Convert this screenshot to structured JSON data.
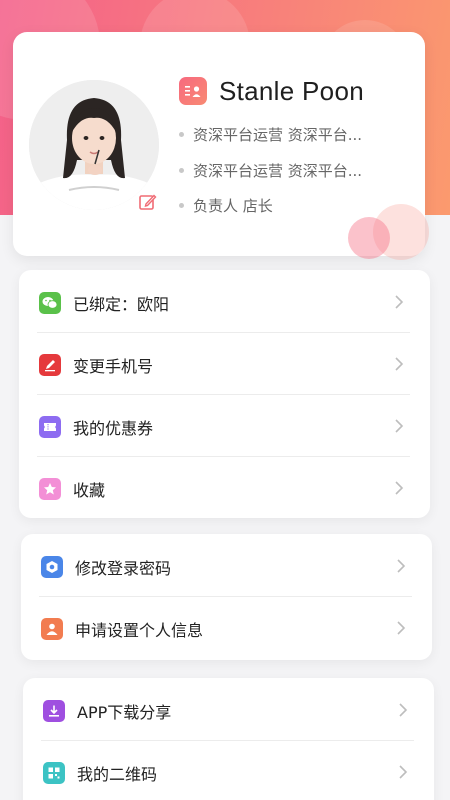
{
  "profile": {
    "name": "Stanle Poon",
    "info_lines": [
      "资深平台运营 资深平台...",
      "资深平台运营 资深平台...",
      "负责人 店长"
    ]
  },
  "menu_groups": [
    {
      "items": [
        {
          "label": "已绑定：欧阳",
          "icon": "wechat-icon",
          "color": "#5ac14a"
        },
        {
          "label": "变更手机号",
          "icon": "edit-phone-icon",
          "color": "#e5393c"
        },
        {
          "label": "我的优惠券",
          "icon": "coupon-icon",
          "color": "#8d6cf1"
        },
        {
          "label": "收藏",
          "icon": "star-icon",
          "color": "#f38fd6"
        }
      ]
    },
    {
      "items": [
        {
          "label": "修改登录密码",
          "icon": "password-shield-icon",
          "color": "#4a86e8"
        },
        {
          "label": "申请设置个人信息",
          "icon": "person-icon",
          "color": "#f27c50"
        }
      ]
    },
    {
      "items": [
        {
          "label": "APP下载分享",
          "icon": "download-icon",
          "color": "#9f4fe0"
        },
        {
          "label": "我的二维码",
          "icon": "qrcode-icon",
          "color": "#3cc3c4"
        }
      ]
    }
  ],
  "colors": {
    "hero_gradient_start": "#f4608a",
    "hero_gradient_end": "#fb9a6e",
    "background": "#f4f4f6"
  }
}
